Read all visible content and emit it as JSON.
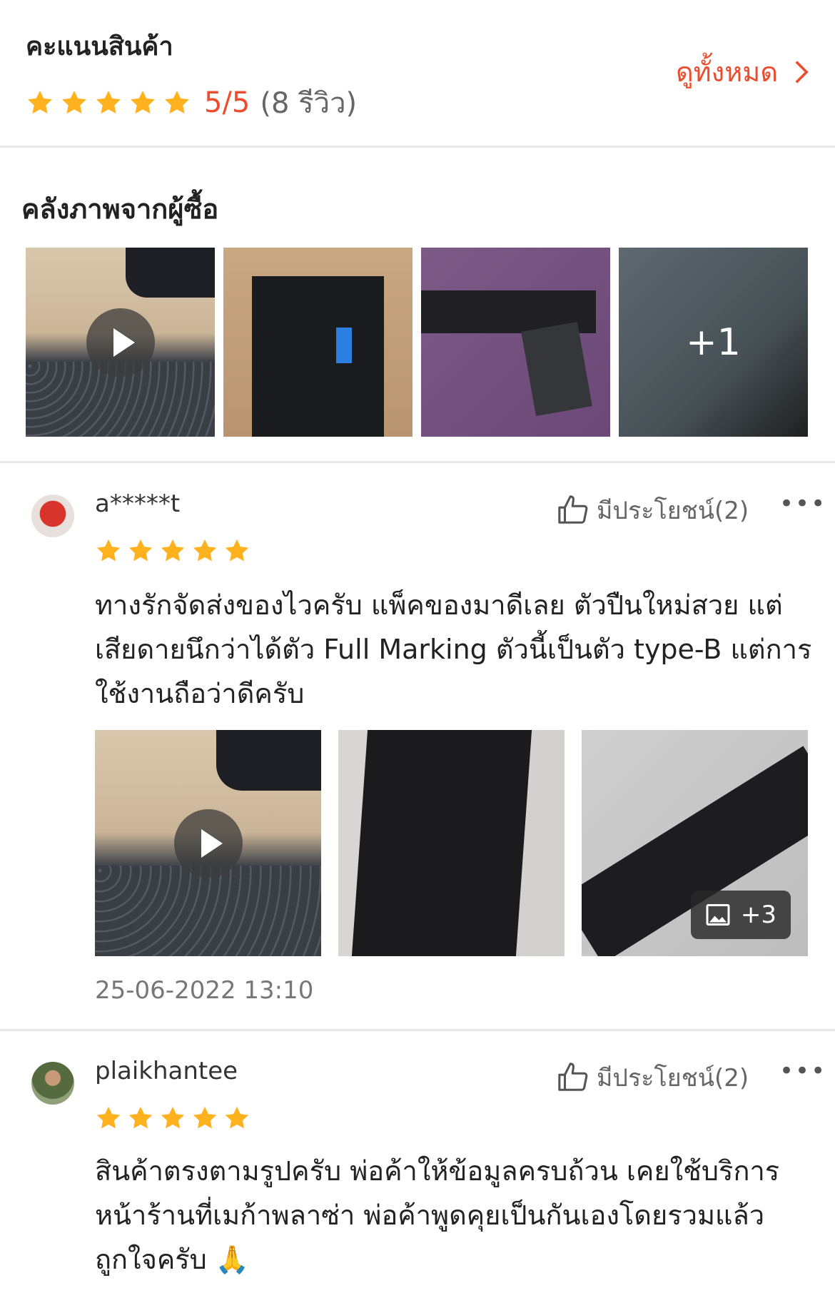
{
  "header": {
    "title": "คะแนนสินค้า",
    "score": "5/5",
    "review_count": "(8 รีวิว)",
    "see_all": "ดูทั้งหมด",
    "stars": 5,
    "accent": "#ee4d2d",
    "star_color": "#ffb21d"
  },
  "gallery": {
    "title": "คลังภาพจากผู้ซื้อ",
    "more_label": "+1"
  },
  "reviews": [
    {
      "username": "a*****t",
      "helpful": "มีประโยชน์(2)",
      "stars": 5,
      "text": "ทางรักจัดส่งของไวครับ แพ็คของมาดีเลย ตัวปืนใหม่สวย แต่เสียดายนึกว่าได้ตัว Full Marking ตัวนี้เป็นตัว type-B แต่การใช้งานถือว่าดีครับ",
      "extra_images": "+3",
      "timestamp": "25-06-2022 13:10"
    },
    {
      "username": "plaikhantee",
      "helpful": "มีประโยชน์(2)",
      "stars": 5,
      "text": "สินค้าตรงตามรูปครับ พ่อค้าให้ข้อมูลครบถ้วน เคยใช้บริการหน้าร้านที่เมก้าพลาซ่า พ่อค้าพูดคุยเป็นกันเองโดยรวมแล้วถูกใจครับ 🙏"
    }
  ]
}
